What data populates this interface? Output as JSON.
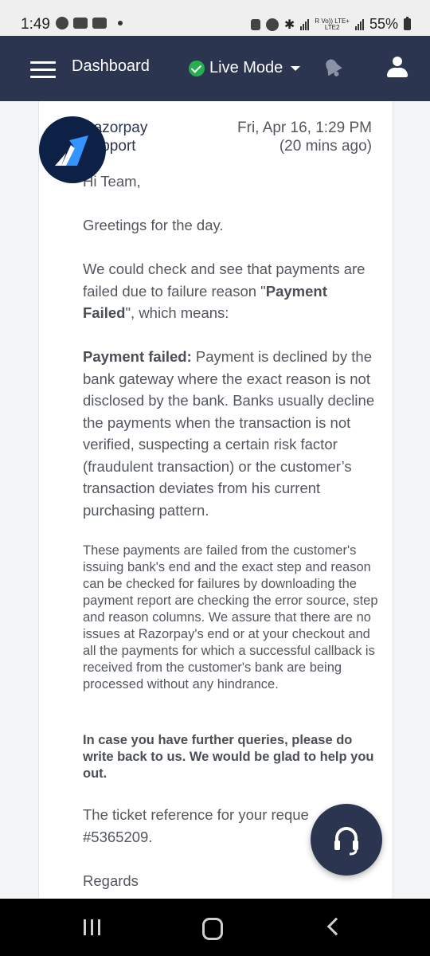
{
  "status_bar": {
    "time": "1:49",
    "network_line1": "R Vo)) LTE+",
    "network_line2": "LTE2",
    "battery": "55%"
  },
  "header": {
    "title": "Dashboard",
    "mode_label": "Live Mode",
    "mode_status_color": "#27ae4f",
    "background_color": "#2c3550"
  },
  "message": {
    "sender_line1": "Razorpay",
    "sender_line2": "Support",
    "date": "Fri, Apr 16, 1:29 PM",
    "relative_time": "(20 mins ago)",
    "greeting": "Hi Team,",
    "line2": "Greetings for the day.",
    "para1_a": "We could check and see that payments are failed due to failure reason \"",
    "para1_bold": "Payment Failed",
    "para1_b": "\", which means:",
    "para2_bold": "Payment failed:",
    "para2_rest": " Payment is declined by the bank gateway where the exact reason is not disclosed by the bank. Banks usually decline the payments when the transaction is not verified, suspecting a certain risk factor (fraudulent transaction) or the customer’s transaction deviates from his current purchasing pattern.",
    "para3": "These payments are failed from the customer's issuing bank's end and the exact step and reason can be checked for failures by downloading the payment report are checking the error source, step and reason columns. We assure that there are no issues at Razorpay's end or at your checkout and all the payments for which a successful callback is received from the customer's bank are being processed without any hindrance.",
    "para4": "In case you have further queries, please do write back to us. We would be glad to help you out.",
    "para5_line1": "The ticket reference for your reque",
    "para5_line2": "#5365209.",
    "closing": "Regards"
  },
  "icons": {
    "bell": "bell-icon",
    "user": "user-icon",
    "support": "headset-icon"
  }
}
